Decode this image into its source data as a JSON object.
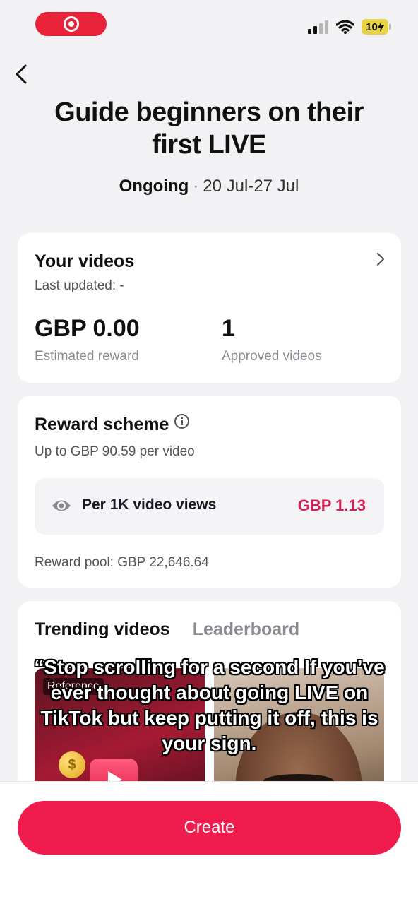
{
  "status_bar": {
    "battery": "10"
  },
  "header": {
    "title": "Guide beginners on their first LIVE",
    "status": "Ongoing",
    "separator": "·",
    "date_range": "20 Jul-27 Jul"
  },
  "your_videos": {
    "title": "Your videos",
    "last_updated": "Last updated: -",
    "estimated_reward_value": "GBP 0.00",
    "estimated_reward_label": "Estimated reward",
    "approved_videos_value": "1",
    "approved_videos_label": "Approved videos"
  },
  "reward_scheme": {
    "title": "Reward scheme",
    "subtitle": "Up to GBP 90.59 per video",
    "rate_label": "Per 1K video views",
    "rate_value": "GBP 1.13",
    "pool": "Reward pool: GBP 22,646.64"
  },
  "trending": {
    "tabs": [
      {
        "label": "Trending videos",
        "active": true
      },
      {
        "label": "Leaderboard",
        "active": false
      }
    ],
    "reference_badge": "Reference",
    "coin_symbol": "$",
    "caption": "“Stop scrolling for a second If you’ve ever thought about going LIVE on TikTok but keep putting it off, this is your sign."
  },
  "footer": {
    "create_label": "Create"
  },
  "colors": {
    "accent": "#f01c4e",
    "reward": "#d81d54",
    "record": "#e8233a"
  }
}
